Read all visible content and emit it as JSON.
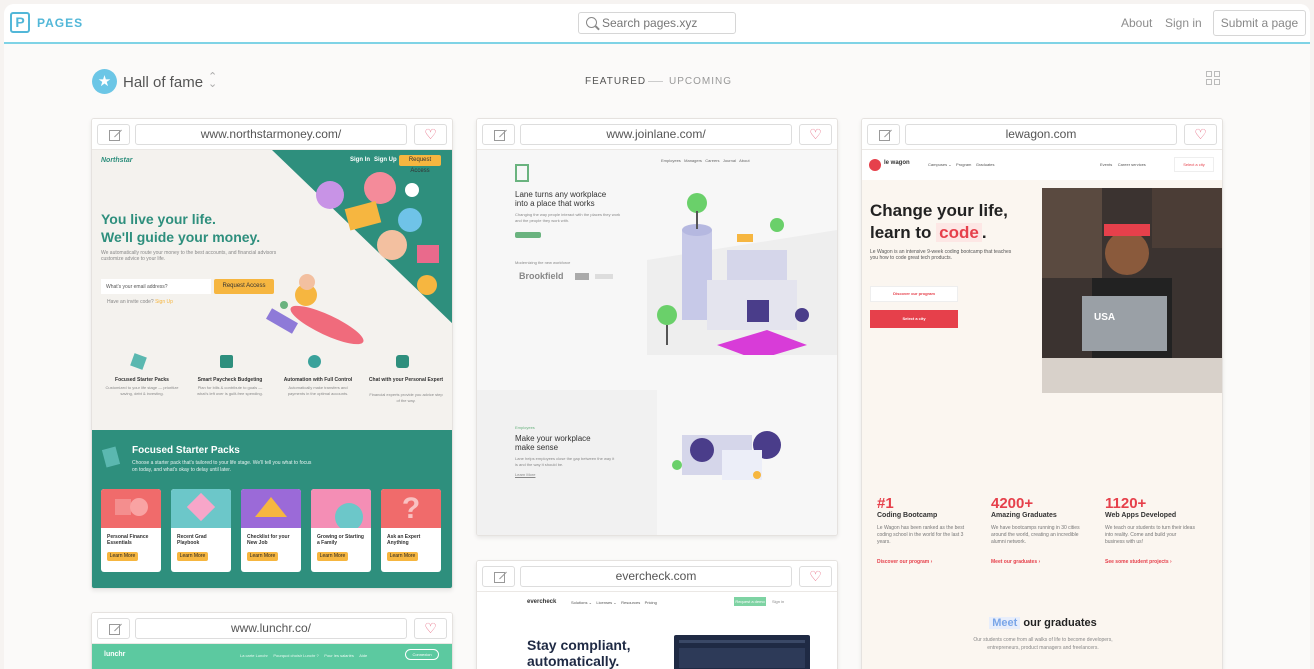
{
  "header": {
    "logo_letter": "P",
    "logo_label": "PAGES",
    "search_placeholder": "Search pages.xyz",
    "nav": [
      "About",
      "Sign in"
    ],
    "submit_label": "Submit a page"
  },
  "toolbar": {
    "hall_label": "Hall of fame",
    "sort_symbol": "⌃⌄",
    "tabs": [
      "FEATURED",
      "UPCOMING"
    ],
    "active_tab": "FEATURED"
  },
  "colors": {
    "brand": "#52b7d8",
    "accent_border": "#7fd3e6",
    "heart": "#e45b75",
    "northstar_teal": "#2e8f7d",
    "northstar_yellow": "#f6b640",
    "lewagon_red": "#e6404b"
  },
  "cards": [
    {
      "url": "www.northstarmoney.com/",
      "site": {
        "brand": "Northstar",
        "nav": [
          "Sign In",
          "Sign Up"
        ],
        "cta": "Request Access",
        "headline": [
          "You live your life.",
          "We'll guide your money."
        ],
        "body": "We automatically route your money to the best accounts, and financial advisors customize advice to your life.",
        "email_placeholder": "What's your email address?",
        "invite_prefix": "Have an invite code?",
        "invite_link": "Sign Up",
        "features": [
          {
            "title": "Focused Starter Packs",
            "text": "Customized to your life stage — prioritize saving, debt & investing."
          },
          {
            "title": "Smart Paycheck Budgeting",
            "text": "Plan for bills & contribute to goals — what's left over is guilt-free spending."
          },
          {
            "title": "Automation with Full Control",
            "text": "Automatically make transfers and payments in the optimal accounts."
          },
          {
            "title": "Chat with your Personal Expert",
            "text": "Financial experts provide you advice step of the way."
          }
        ],
        "section_title": "Focused Starter Packs",
        "section_text": "Choose a starter pack that's tailored to your life stage. We'll tell you what to focus on today, and what's okay to delay until later.",
        "packs": [
          "Personal Finance Essentials",
          "Recent Grad Playbook",
          "Checklist for your New Job",
          "Growing or Starting a Family",
          "Ask an Expert Anything"
        ],
        "pack_button": "Learn More"
      }
    },
    {
      "url": "www.joinlane.com/",
      "site": {
        "nav": [
          "Employees",
          "Managers",
          "Careers",
          "Journal",
          "About"
        ],
        "headline": [
          "Lane turns any workplace",
          "into a place that works"
        ],
        "body": "Changing the way people interact with the places they work and the people they work with.",
        "trusted": "Modernizing the new workforce",
        "logo_text": "Brookfield",
        "section_label": "Employees",
        "section_title": [
          "Make your workplace",
          "make sense"
        ],
        "section_text": "Lane helps employees close the gap between the way it is and the way it should be.",
        "section_link": "Learn More"
      }
    },
    {
      "url": "lewagon.com",
      "site": {
        "brand": "le wagon",
        "nav": [
          "Campuses ⌄",
          "Program",
          "Graduates"
        ],
        "nav_right": [
          "Events",
          "Career services"
        ],
        "nav_cta": "Select a city",
        "headline_1": "Change your life,",
        "headline_2": "learn to",
        "headline_code": "code",
        "headline_end": ".",
        "body": "Le Wagon is an intensive 9-week coding bootcamp that teaches you how to code great tech products.",
        "btn_program": "Discover our program",
        "btn_city": "Select a city",
        "stats": [
          {
            "value": "#1",
            "label": "Coding Bootcamp",
            "text": "Le Wagon has been ranked as the best coding school in the world for the last 3 years.",
            "link": "Discover our program ›"
          },
          {
            "value": "4200+",
            "label": "Amazing Graduates",
            "text": "We have bootcamps running in 30 cities around the world, creating an incredible alumni network.",
            "link": "Meet our graduates ›"
          },
          {
            "value": "1120+",
            "label": "Web Apps Developed",
            "text": "We teach our students to turn their ideas into reality. Come and build your business with us!",
            "link": "See some student projects ›"
          }
        ],
        "meet": "Meet",
        "graduates": "our graduates",
        "grad_text": [
          "Our students come from all walks of life to become developers,",
          "entrepreneurs, product managers and freelancers."
        ]
      }
    },
    {
      "url": "evercheck.com",
      "site": {
        "brand": "evercheck",
        "nav": [
          "Solutions ⌄",
          "Licenses ⌄",
          "Resources",
          "Pricing"
        ],
        "cta": "Request a demo",
        "signin": "Sign in",
        "headline": [
          "Stay compliant,",
          "automatically."
        ]
      }
    },
    {
      "url": "www.lunchr.co/",
      "site": {
        "brand": "lunchr",
        "nav": [
          "La carte Lunchr",
          "Pourquoi choisir Lunchr ?",
          "Pour les salariés",
          "Aide"
        ],
        "cta": "Connexion"
      }
    }
  ]
}
